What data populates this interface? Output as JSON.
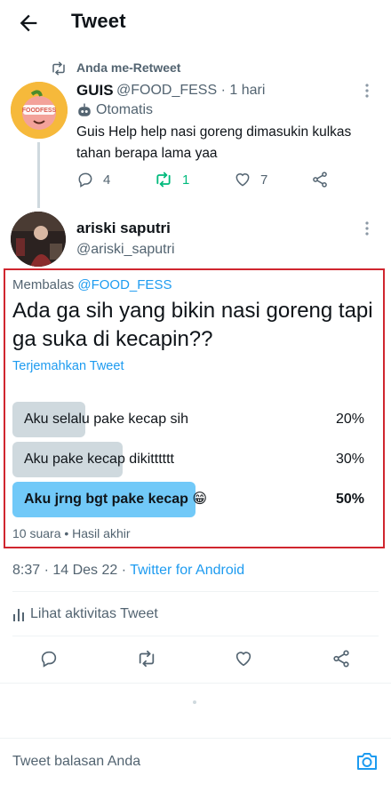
{
  "header": {
    "title": "Tweet",
    "back_icon": "arrow-left-icon"
  },
  "retweet_context": {
    "label": "Anda me-Retweet"
  },
  "retweeted_tweet": {
    "author_name": "GUIS",
    "author_handle": "@FOOD_FESS · 1 hari",
    "avatar_text": "FOODFESS",
    "automated_label": "Otomatis",
    "text": "Guis Help help nasi goreng dimasukin kulkas tahan berapa lama yaa",
    "replies": "4",
    "retweets": "1",
    "likes": "7"
  },
  "main_tweet": {
    "author_name": "ariski saputri",
    "author_handle": "@ariski_saputri",
    "replying_prefix": "Membalas",
    "replying_to": "@FOOD_FESS",
    "text": "Ada ga sih yang bikin nasi goreng tapi ga suka di kecapin??",
    "translate_link": "Terjemahkan Tweet",
    "poll": {
      "options": [
        {
          "label": "Aku selalu pake kecap sih",
          "percent": "20%",
          "fraction": 0.2,
          "winner": false
        },
        {
          "label": "Aku pake kecap dikitttttt",
          "percent": "30%",
          "fraction": 0.3,
          "winner": false
        },
        {
          "label": "Aku jrng bgt pake kecap 😁",
          "percent": "50%",
          "fraction": 0.5,
          "winner": true
        }
      ],
      "info": "10 suara • Hasil akhir"
    },
    "timestamp": "8:37 · 14 Des 22 · ",
    "source": "Twitter for Android",
    "activity_label": "Lihat aktivitas Tweet"
  },
  "reply_bar": {
    "placeholder": "Tweet balasan Anda",
    "camera_icon": "camera-icon"
  },
  "colors": {
    "accent": "#1d9bf0",
    "retweet_green": "#00ba7c",
    "highlight_border": "#d0262f",
    "poll_winner": "#71c9f8",
    "poll_bar": "#cfd9de"
  }
}
